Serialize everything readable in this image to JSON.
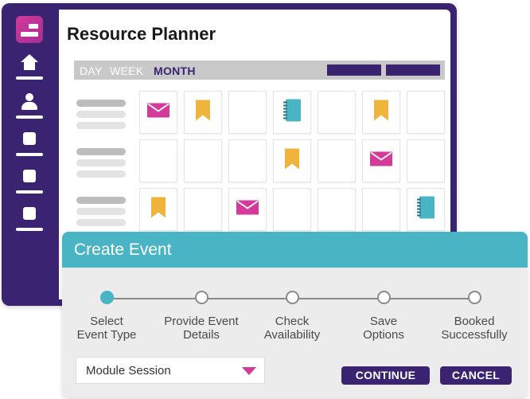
{
  "app": {
    "title": "Resource Planner"
  },
  "calendar": {
    "tabs": [
      {
        "label": "DAY",
        "active": false
      },
      {
        "label": "WEEK",
        "active": false
      },
      {
        "label": "MONTH",
        "active": true
      }
    ],
    "rows": [
      {
        "cells": [
          "envelope-icon",
          "bookmark-icon",
          "",
          "notebook-icon",
          "",
          "bookmark-icon",
          ""
        ]
      },
      {
        "cells": [
          "",
          "",
          "",
          "bookmark-icon",
          "",
          "envelope-icon",
          ""
        ]
      },
      {
        "cells": [
          "bookmark-icon",
          "",
          "envelope-icon",
          "",
          "",
          "",
          "notebook-icon"
        ]
      }
    ]
  },
  "sidebar": {
    "items": [
      {
        "icon": "home-icon"
      },
      {
        "icon": "user-icon"
      },
      {
        "icon": "square-icon"
      },
      {
        "icon": "square-icon"
      },
      {
        "icon": "square-icon"
      }
    ]
  },
  "dialog": {
    "title": "Create Event",
    "steps": [
      {
        "label": "Select\nEvent Type",
        "done": true
      },
      {
        "label": "Provide Event\nDetails",
        "done": false
      },
      {
        "label": "Check\nAvailability",
        "done": false
      },
      {
        "label": "Save\nOptions",
        "done": false
      },
      {
        "label": "Booked\nSuccessfully",
        "done": false
      }
    ],
    "select_value": "Module Session",
    "continue_label": "CONTINUE",
    "cancel_label": "CANCEL"
  },
  "colors": {
    "purple": "#3a2472",
    "magenta": "#d43a9a",
    "teal": "#49b4c3",
    "gold": "#f0b43c"
  }
}
